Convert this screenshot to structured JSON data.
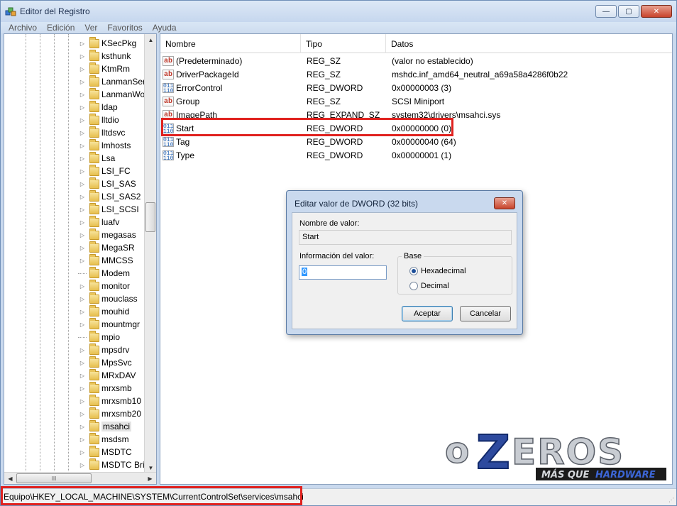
{
  "window": {
    "title": "Editor del Registro",
    "controls": {
      "minimize": "—",
      "maximize": "▢",
      "close": "✕"
    }
  },
  "menu": [
    "Archivo",
    "Edición",
    "Ver",
    "Favoritos",
    "Ayuda"
  ],
  "tree": {
    "items": [
      {
        "label": "KSecPkg",
        "expandable": true
      },
      {
        "label": "ksthunk",
        "expandable": true
      },
      {
        "label": "KtmRm",
        "expandable": true
      },
      {
        "label": "LanmanSer",
        "expandable": true
      },
      {
        "label": "LanmanWo",
        "expandable": true
      },
      {
        "label": "ldap",
        "expandable": true
      },
      {
        "label": "lltdio",
        "expandable": true
      },
      {
        "label": "lltdsvc",
        "expandable": true
      },
      {
        "label": "lmhosts",
        "expandable": true
      },
      {
        "label": "Lsa",
        "expandable": true
      },
      {
        "label": "LSI_FC",
        "expandable": true
      },
      {
        "label": "LSI_SAS",
        "expandable": true
      },
      {
        "label": "LSI_SAS2",
        "expandable": true
      },
      {
        "label": "LSI_SCSI",
        "expandable": true
      },
      {
        "label": "luafv",
        "expandable": true
      },
      {
        "label": "megasas",
        "expandable": true
      },
      {
        "label": "MegaSR",
        "expandable": true
      },
      {
        "label": "MMCSS",
        "expandable": true
      },
      {
        "label": "Modem",
        "expandable": false
      },
      {
        "label": "monitor",
        "expandable": true
      },
      {
        "label": "mouclass",
        "expandable": true
      },
      {
        "label": "mouhid",
        "expandable": true
      },
      {
        "label": "mountmgr",
        "expandable": true
      },
      {
        "label": "mpio",
        "expandable": false
      },
      {
        "label": "mpsdrv",
        "expandable": true
      },
      {
        "label": "MpsSvc",
        "expandable": true
      },
      {
        "label": "MRxDAV",
        "expandable": true
      },
      {
        "label": "mrxsmb",
        "expandable": true
      },
      {
        "label": "mrxsmb10",
        "expandable": true
      },
      {
        "label": "mrxsmb20",
        "expandable": true
      },
      {
        "label": "msahci",
        "expandable": true,
        "selected": true
      },
      {
        "label": "msdsm",
        "expandable": true
      },
      {
        "label": "MSDTC",
        "expandable": true
      },
      {
        "label": "MSDTC Bri",
        "expandable": true
      }
    ],
    "hscroll_grip": "III"
  },
  "list": {
    "columns": [
      "Nombre",
      "Tipo",
      "Datos"
    ],
    "rows": [
      {
        "name": "(Predeterminado)",
        "type": "REG_SZ",
        "data": "(valor no establecido)",
        "icon": "string-value-icon"
      },
      {
        "name": "DriverPackageId",
        "type": "REG_SZ",
        "data": "mshdc.inf_amd64_neutral_a69a58a4286f0b22",
        "icon": "string-value-icon"
      },
      {
        "name": "ErrorControl",
        "type": "REG_DWORD",
        "data": "0x00000003 (3)",
        "icon": "dword-value-icon"
      },
      {
        "name": "Group",
        "type": "REG_SZ",
        "data": "SCSI Miniport",
        "icon": "string-value-icon"
      },
      {
        "name": "ImagePath",
        "type": "REG_EXPAND_SZ",
        "data": "system32\\drivers\\msahci.sys",
        "icon": "string-value-icon"
      },
      {
        "name": "Start",
        "type": "REG_DWORD",
        "data": "0x00000000 (0)",
        "icon": "dword-value-icon"
      },
      {
        "name": "Tag",
        "type": "REG_DWORD",
        "data": "0x00000040 (64)",
        "icon": "dword-value-icon"
      },
      {
        "name": "Type",
        "type": "REG_DWORD",
        "data": "0x00000001 (1)",
        "icon": "dword-value-icon"
      }
    ]
  },
  "dialog": {
    "title": "Editar valor de DWORD (32 bits)",
    "name_label": "Nombre de valor:",
    "name_value": "Start",
    "data_label": "Información del valor:",
    "data_value": "0",
    "base_label": "Base",
    "hex_label": "Hexadecimal",
    "dec_label": "Decimal",
    "base_selected": "Hexadecimal",
    "ok_label": "Aceptar",
    "cancel_label": "Cancelar"
  },
  "statusbar": {
    "path": "Equipo\\HKEY_LOCAL_MACHINE\\SYSTEM\\CurrentControlSet\\services\\msahci"
  },
  "logo": {
    "main": "oZEROS",
    "tagline_a": "MÁS QUE",
    "tagline_b": "HARDWARE"
  },
  "colors": {
    "highlight": "#e0221f",
    "logo_blue": "#2d4a9e",
    "logo_silver": "#c8ccd2",
    "window_frame": "#c9d9ee"
  }
}
